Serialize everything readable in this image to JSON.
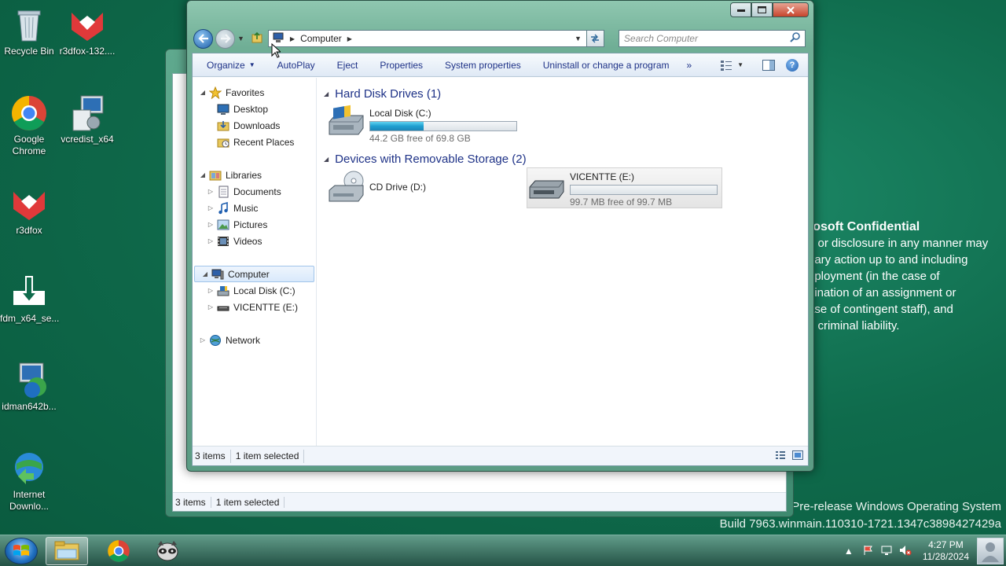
{
  "desktop": {
    "icons": [
      {
        "label": "Recycle Bin"
      },
      {
        "label": "r3dfox-132...."
      },
      {
        "label": "Google Chrome"
      },
      {
        "label": "vcredist_x64"
      },
      {
        "label": "r3dfox"
      },
      {
        "label": "fdm_x64_se..."
      },
      {
        "label": "idman642b..."
      },
      {
        "label": "Internet Downlo..."
      }
    ],
    "watermark_lines": [
      "rosoft Confidential",
      "e or disclosure in any manner may",
      "nary action up to and including",
      "nployment (in the case of",
      "nination of an assignment or",
      "ase of contingent staff), and",
      "d criminal liability."
    ],
    "build_lines": [
      "Pre-release Windows Operating System",
      "Build 7963.winmain.110310-1721.1347c3898427429a"
    ]
  },
  "bg_window": {
    "status_items": "3 items",
    "status_selected": "1 item selected"
  },
  "window": {
    "address": {
      "root": "Computer"
    },
    "search_placeholder": "Search Computer",
    "commands": {
      "organize": "Organize",
      "autoplay": "AutoPlay",
      "eject": "Eject",
      "properties": "Properties",
      "system_properties": "System properties",
      "uninstall": "Uninstall or change a program",
      "more": "»"
    },
    "nav": {
      "favorites": "Favorites",
      "desktop": "Desktop",
      "downloads": "Downloads",
      "recent_places": "Recent Places",
      "libraries": "Libraries",
      "documents": "Documents",
      "music": "Music",
      "pictures": "Pictures",
      "videos": "Videos",
      "computer": "Computer",
      "local_disk": "Local Disk (C:)",
      "vicentte": "VICENTTE (E:)",
      "network": "Network"
    },
    "groups": {
      "hdd": "Hard Disk Drives (1)",
      "removable": "Devices with Removable Storage (2)"
    },
    "drives": {
      "c": {
        "name": "Local Disk (C:)",
        "free": "44.2 GB free of 69.8 GB",
        "used_fraction": 0.367
      },
      "d": {
        "name": "CD Drive (D:)"
      },
      "e": {
        "name": "VICENTTE (E:)",
        "free": "99.7 MB free of 99.7 MB",
        "used_fraction": 0.0
      }
    },
    "status": {
      "items": "3 items",
      "selected": "1 item selected"
    }
  },
  "taskbar": {
    "time": "4:27 PM",
    "date": "11/28/2024"
  }
}
